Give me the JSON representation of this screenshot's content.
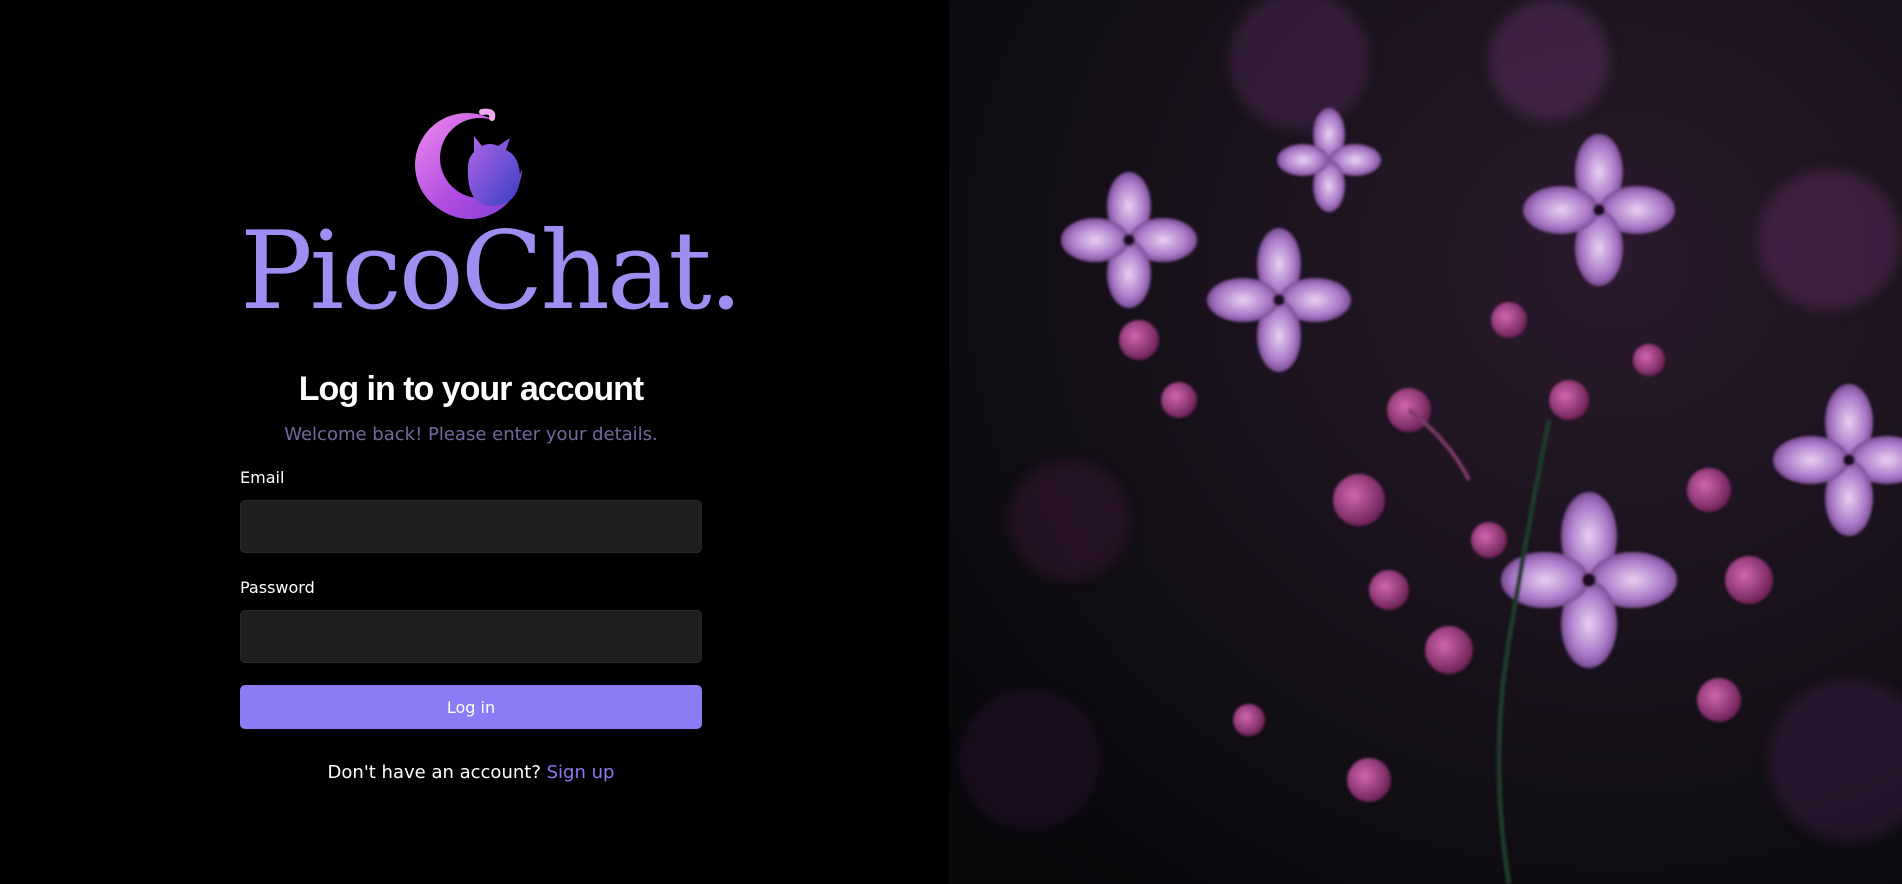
{
  "brand": {
    "name": "PicoChat.",
    "logo_icon": "cat-moon-logo-icon",
    "color": "#9d8ff2"
  },
  "login": {
    "heading": "Log in to your account",
    "subheading": "Welcome back! Please enter your details.",
    "email_label": "Email",
    "email_value": "",
    "password_label": "Password",
    "password_value": "",
    "submit_label": "Log in",
    "no_account_text": "Don't have an account?",
    "signup_link": "Sign up",
    "accent": "#8b7cf6"
  },
  "hero": {
    "image": "lilac-flowers-photo"
  }
}
